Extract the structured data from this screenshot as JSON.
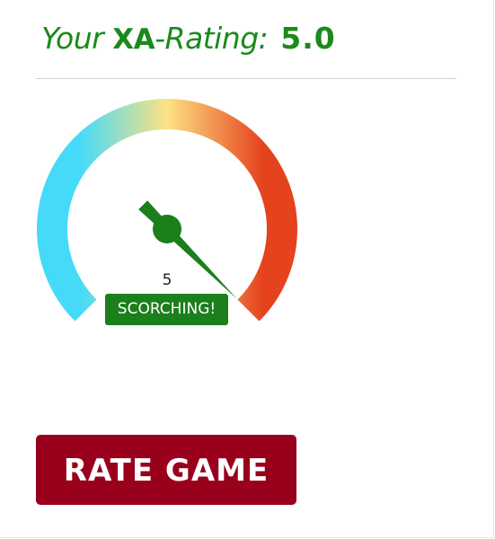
{
  "rating": {
    "title_prefix": "Your ",
    "title_brand": "XA",
    "title_suffix": "-Rating:",
    "score": "5.0"
  },
  "gauge": {
    "value": 5,
    "value_label": "5",
    "min": 0,
    "max": 5,
    "status_label": "SCORCHING!",
    "gradient_colors": [
      "#45daf8",
      "#fde283",
      "#e5421e"
    ],
    "needle_color": "#1b7f1b",
    "label_color": "#1b7f1b"
  },
  "actions": {
    "rate_button_label": "RATE GAME",
    "rate_button_color": "#98001c"
  },
  "theme": {
    "accent": "#1b8a1b"
  }
}
